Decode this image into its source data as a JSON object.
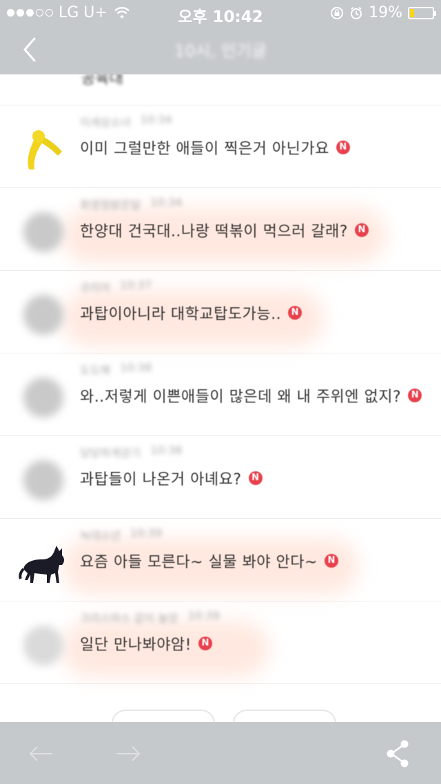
{
  "status_bar": {
    "carrier": "LG U+",
    "time": "오후 10:42",
    "battery": "19%",
    "battery_level": 0.19
  },
  "nav": {
    "title": "10시, 인기글"
  },
  "partial_comment": "공육대",
  "comments": [
    {
      "author": "이세상소녀",
      "time": "10:34",
      "text": "이미 그럴만한 애들이 찍은거 아닌가요",
      "badge": "N"
    },
    {
      "author": "휘영청밝은달",
      "time": "10:34",
      "text": "한양대 건국대..나랑 떡볶이 먹으러 갈래?",
      "badge": "N"
    },
    {
      "author": "코리아",
      "time": "10:37",
      "text": "과탑이아니라 대학교탑도가능..",
      "badge": "N"
    },
    {
      "author": "도도해",
      "time": "10:38",
      "text": "와..저렇게 이쁜애들이 많은데 왜 내 주위엔 없지?",
      "badge": "N"
    },
    {
      "author": "당당하게걷기",
      "time": "10:38",
      "text": "과탑들이 나온거 아녜요?",
      "badge": "N"
    },
    {
      "author": "늑대소년",
      "time": "10:39",
      "text": "요즘 아들 모른다~ 실물 봐야 안다~",
      "badge": "N"
    },
    {
      "author": "크리스마스 같이 놀았",
      "time": "10:39",
      "text": "일단 만나봐야암!",
      "badge": "N"
    }
  ],
  "colors": {
    "bar_gray": "#c6c9cc",
    "badge_red": "#e8414d",
    "battery_yellow": "#ffd60a"
  }
}
